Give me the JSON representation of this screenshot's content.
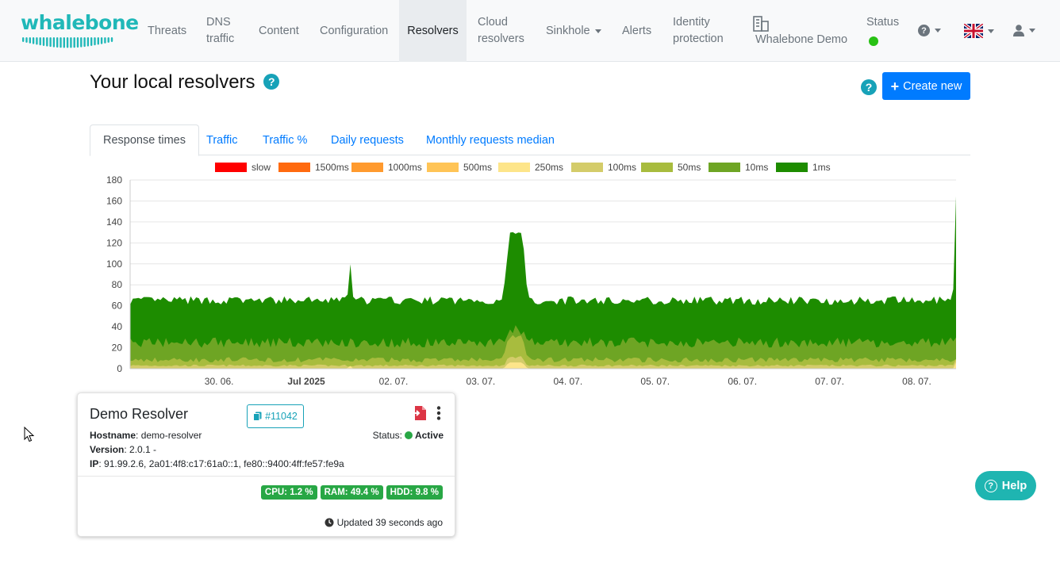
{
  "nav": {
    "brand": "whalebone",
    "items": [
      {
        "label_line1": "Threats",
        "label_line2": ""
      },
      {
        "label_line1": "DNS",
        "label_line2": "traffic"
      },
      {
        "label_line1": "Content",
        "label_line2": ""
      },
      {
        "label_line1": "Configuration",
        "label_line2": ""
      },
      {
        "label_line1": "Resolvers",
        "label_line2": ""
      },
      {
        "label_line1": "Cloud",
        "label_line2": "resolvers"
      },
      {
        "label_line1": "Sinkhole",
        "label_line2": ""
      },
      {
        "label_line1": "Alerts",
        "label_line2": ""
      },
      {
        "label_line1": "Identity",
        "label_line2": "protection"
      }
    ],
    "org_name": "Whalebone Demo",
    "status_label": "Status",
    "status_color": "#28c114",
    "help_icon": "question-circle-icon",
    "language_icon": "uk-flag-icon",
    "user_icon": "user-icon"
  },
  "page": {
    "title": "Your local resolvers",
    "create_label": "Create new"
  },
  "tabs": [
    "Response times",
    "Traffic",
    "Traffic %",
    "Daily requests",
    "Monthly requests median"
  ],
  "chart_data": {
    "type": "area",
    "legend": [
      {
        "name": "slow",
        "color": "#ff0000"
      },
      {
        "name": "1500ms",
        "color": "#ff6a0f"
      },
      {
        "name": "1000ms",
        "color": "#ff9a2e"
      },
      {
        "name": "500ms",
        "color": "#ffc456"
      },
      {
        "name": "250ms",
        "color": "#fde58a"
      },
      {
        "name": "100ms",
        "color": "#d4cc6a"
      },
      {
        "name": "50ms",
        "color": "#a8bc3e"
      },
      {
        "name": "10ms",
        "color": "#6ea524"
      },
      {
        "name": "1ms",
        "color": "#1d8c00"
      }
    ],
    "legend_placement": "top",
    "ylim": [
      0,
      180
    ],
    "yticks": [
      0,
      20,
      40,
      60,
      80,
      100,
      120,
      140,
      160,
      180
    ],
    "xticks": [
      {
        "label": "30. 06.",
        "bold": false
      },
      {
        "label": "Jul 2025",
        "bold": true
      },
      {
        "label": "02. 07.",
        "bold": false
      },
      {
        "label": "03. 07.",
        "bold": false
      },
      {
        "label": "04. 07.",
        "bold": false
      },
      {
        "label": "05. 07.",
        "bold": false
      },
      {
        "label": "06. 07.",
        "bold": false
      },
      {
        "label": "07. 07.",
        "bold": false
      },
      {
        "label": "08. 07.",
        "bold": false
      }
    ],
    "x_days": [
      -0.9,
      0.1,
      1.1,
      2.1,
      3.1,
      4.1,
      5.1,
      6.1,
      7.1
    ],
    "x_range_days": [
      -1.92,
      7.55
    ],
    "series_summary": {
      "total_typical": 63,
      "spikes": [
        {
          "day": 0.6,
          "value": 102
        },
        {
          "day": 2.5,
          "value": 126
        },
        {
          "day": 7.55,
          "value": 160
        }
      ],
      "10ms_typical": 25,
      "50ms_typical": 8,
      "100ms_typical": 2
    },
    "grid": true
  },
  "resolver": {
    "name": "Demo Resolver",
    "id_label": "#11042",
    "hostname_label": "Hostname",
    "hostname": "demo-resolver",
    "version_label": "Version",
    "version": "2.0.1 -",
    "ip_label": "IP",
    "ip": "91.99.2.6, 2a01:4f8:c17:61a0::1, fe80::9400:4ff:fe57:fe9a",
    "status_label": "Status:",
    "status": "Active",
    "cpu": "CPU: 1.2 %",
    "ram": "RAM: 49.4 %",
    "hdd": "HDD: 9.8 %",
    "updated": "Updated 39 seconds ago"
  },
  "help": {
    "label": "Help"
  }
}
